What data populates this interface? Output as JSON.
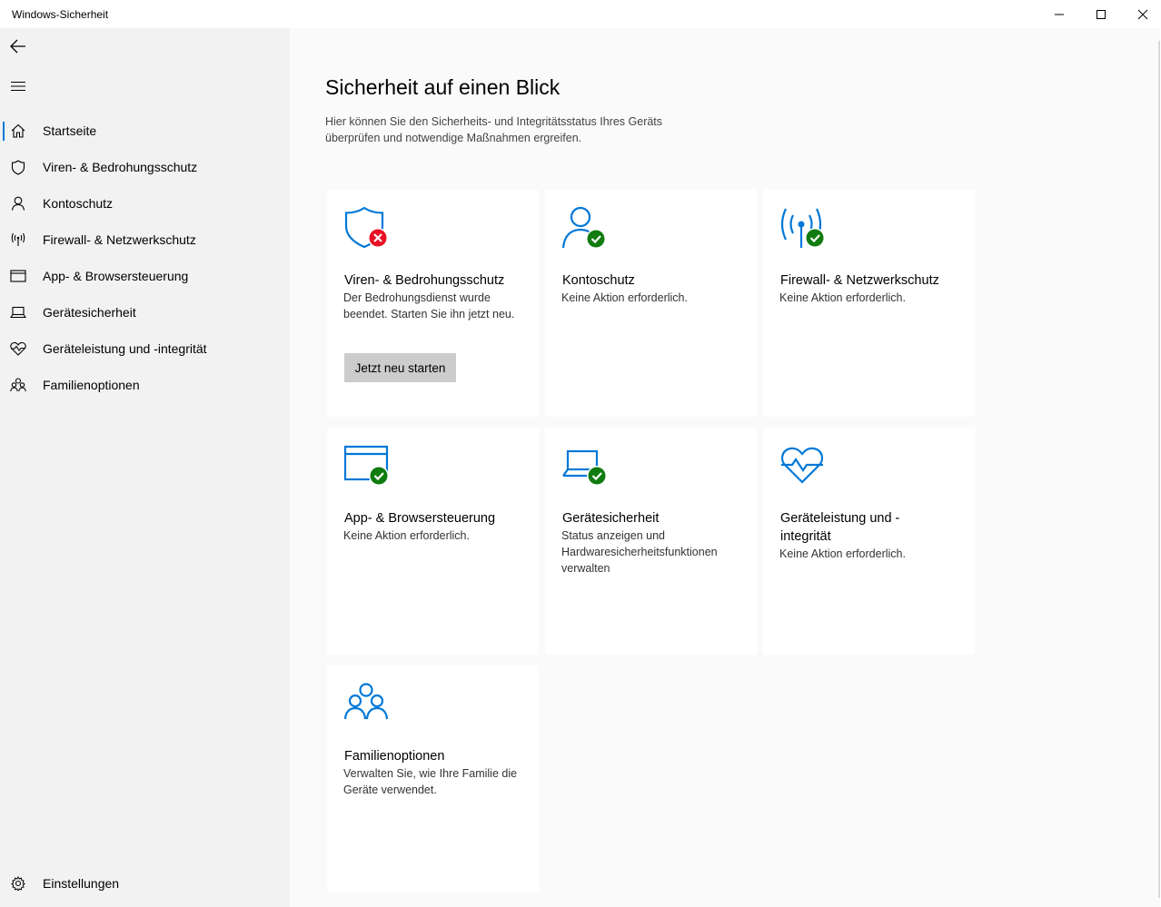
{
  "window": {
    "title": "Windows-Sicherheit"
  },
  "sidebar": {
    "items": [
      {
        "label": "Startseite",
        "icon": "home-icon"
      },
      {
        "label": "Viren- & Bedrohungsschutz",
        "icon": "shield-icon"
      },
      {
        "label": "Kontoschutz",
        "icon": "person-icon"
      },
      {
        "label": "Firewall- & Netzwerkschutz",
        "icon": "antenna-icon"
      },
      {
        "label": "App- & Browsersteuerung",
        "icon": "browser-window-icon"
      },
      {
        "label": "Gerätesicherheit",
        "icon": "laptop-icon"
      },
      {
        "label": "Geräteleistung und -integrität",
        "icon": "heart-pulse-icon"
      },
      {
        "label": "Familienoptionen",
        "icon": "family-icon"
      }
    ],
    "selected": "Startseite",
    "settings_label": "Einstellungen"
  },
  "main": {
    "title": "Sicherheit auf einen Blick",
    "description": "Hier können Sie den Sicherheits- und Integritätsstatus Ihres Geräts überprüfen und notwendige Maßnahmen ergreifen.",
    "cards": [
      {
        "title": "Viren- & Bedrohungsschutz",
        "description": "Der Bedrohungsdienst wurde beendet. Starten Sie ihn jetzt neu.",
        "status": "error",
        "button": "Jetzt neu starten"
      },
      {
        "title": "Kontoschutz",
        "description": "Keine Aktion erforderlich.",
        "status": "ok"
      },
      {
        "title": "Firewall- & Netzwerkschutz",
        "description": "Keine Aktion erforderlich.",
        "status": "ok"
      },
      {
        "title": "App- & Browsersteuerung",
        "description": "Keine Aktion erforderlich.",
        "status": "ok"
      },
      {
        "title": "Gerätesicherheit",
        "description": "Status anzeigen und Hardwaresicherheitsfunktionen verwalten",
        "status": "ok"
      },
      {
        "title": "Geräteleistung und -integrität",
        "description": "Keine Aktion erforderlich.",
        "status": "none"
      },
      {
        "title": "Familienoptionen",
        "description": "Verwalten Sie, wie Ihre Familie die Geräte verwendet.",
        "status": "none"
      }
    ]
  },
  "colors": {
    "accent": "#0078d7",
    "ok": "#107c10",
    "error": "#e81123"
  }
}
